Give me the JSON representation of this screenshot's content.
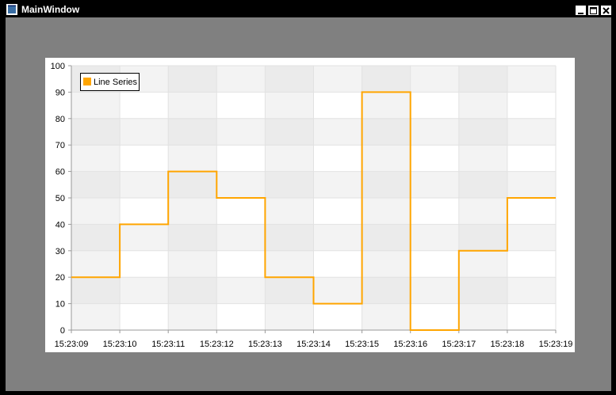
{
  "window": {
    "title": "MainWindow"
  },
  "colors": {
    "series": "#FFA500",
    "client_bg": "#808080",
    "titlebar_bg": "#000000"
  },
  "icons": {
    "app": "window-app-icon",
    "minimize": "minimize-icon",
    "maximize": "maximize-icon",
    "close": "close-icon"
  },
  "chart_data": {
    "type": "line",
    "interpolation": "step-after",
    "x": [
      "15:23:09",
      "15:23:10",
      "15:23:11",
      "15:23:12",
      "15:23:13",
      "15:23:14",
      "15:23:15",
      "15:23:16",
      "15:23:17",
      "15:23:18",
      "15:23:19"
    ],
    "series": [
      {
        "name": "Line Series",
        "color": "#FFA500",
        "values": [
          20,
          40,
          60,
          50,
          20,
          10,
          90,
          0,
          30,
          50,
          50
        ]
      }
    ],
    "ylim": [
      0,
      100
    ],
    "yticks": [
      0,
      10,
      20,
      30,
      40,
      50,
      60,
      70,
      80,
      90,
      100
    ],
    "grid": true,
    "legend": {
      "position": "top-left",
      "entries": [
        "Line Series"
      ]
    },
    "xlabel": "",
    "ylabel": ""
  }
}
